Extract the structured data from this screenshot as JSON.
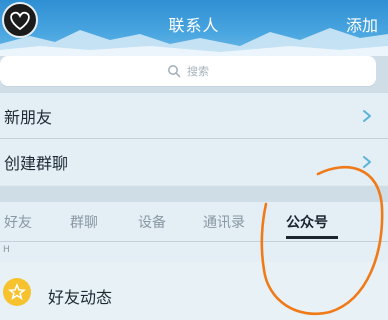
{
  "header": {
    "title": "联系人",
    "add_label": "添加"
  },
  "search": {
    "placeholder": "搜索"
  },
  "rows": [
    {
      "label": "新朋友"
    },
    {
      "label": "创建群聊"
    }
  ],
  "tabs": [
    {
      "label": "好友",
      "active": false
    },
    {
      "label": "群聊",
      "active": false
    },
    {
      "label": "设备",
      "active": false
    },
    {
      "label": "通讯录",
      "active": false
    },
    {
      "label": "公众号",
      "active": true
    }
  ],
  "section": {
    "index_letter": "H"
  },
  "feed": {
    "label": "好友动态"
  },
  "colors": {
    "header_blue": "#3a98d8",
    "accent_orange": "#f07a18",
    "star_yellow": "#f6c22e",
    "background": "#dde8ef"
  },
  "icons": {
    "avatar": "heart-avatar",
    "search": "search-icon",
    "chevron": "chevron-right-icon",
    "feed": "star-icon"
  }
}
